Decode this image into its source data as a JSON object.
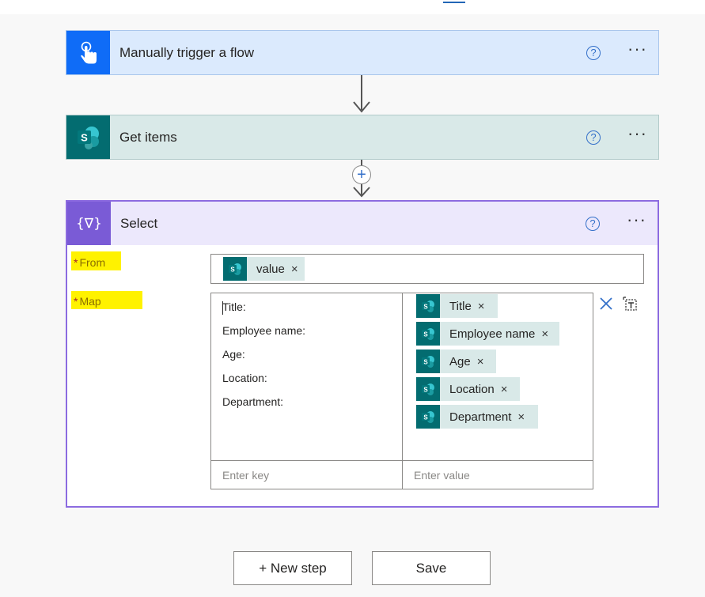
{
  "steps": {
    "trigger": {
      "title": "Manually trigger a flow",
      "help": "?",
      "more": "···"
    },
    "get_items": {
      "title": "Get items",
      "help": "?",
      "more": "···"
    },
    "select": {
      "title": "Select",
      "help": "?",
      "more": "···",
      "icon_text": "{∇}",
      "from_label": "From",
      "map_label": "Map",
      "required_mark": "*",
      "from_token": "value",
      "map_keys": [
        "Title:",
        "Employee name:",
        "Age:",
        "Location:",
        "Department:"
      ],
      "map_values": [
        "Title",
        "Employee name",
        "Age",
        "Location",
        "Department"
      ],
      "key_placeholder": "Enter key",
      "value_placeholder": "Enter value"
    }
  },
  "insert_step_symbol": "+",
  "token_close": "×",
  "buttons": {
    "new_step": "+ New step",
    "save": "Save"
  },
  "colors": {
    "trigger_accent": "#0f6cf7",
    "sharepoint_accent": "#036c70",
    "select_accent": "#7a5bd6",
    "highlight": "#fff200"
  },
  "icons": {
    "trigger": "touch-hand-icon",
    "get_items": "sharepoint-icon",
    "select": "data-operation-icon",
    "clear_map": "close-icon",
    "switch_mode": "text-mode-icon"
  }
}
